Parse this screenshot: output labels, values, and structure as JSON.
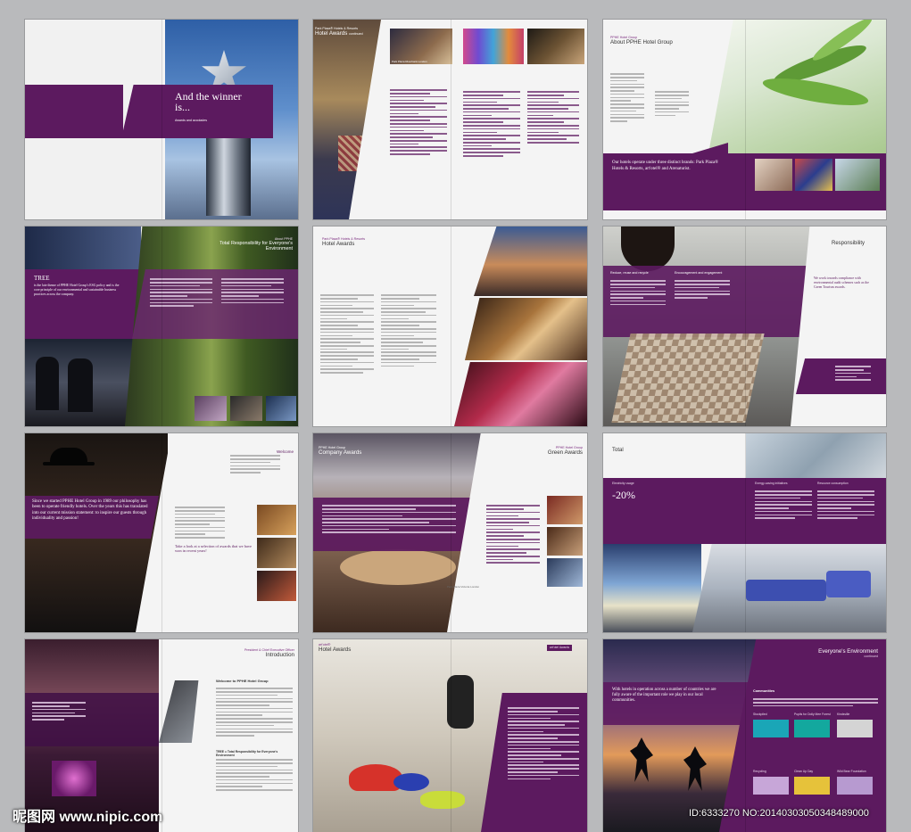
{
  "spreads": {
    "s1": {
      "title": "And the winner is...",
      "subtitle": "Awards and accolades"
    },
    "s2": {
      "brand": "Park Plaza® Hotels & Resorts",
      "title": "Hotel Awards",
      "title_suffix": "continued",
      "caption": "Park Plaza Riverbank London"
    },
    "s3": {
      "brand": "PPHE Hotel Group",
      "title": "About PPHE Hotel Group",
      "quote": "Our hotels operate under three distinct brands: Park Plaza® Hotels & Resorts, art'otel® and Arenaturist."
    },
    "s4": {
      "brand": "About PPHE",
      "title": "Total Responsibility for Everyone's Environment",
      "lead_title": "TREE",
      "lead_text": "is the late theme of PPHE Hotel Group's ESG policy and is the core principle of our environmental and sustainable business practices across the company."
    },
    "s5": {
      "brand": "Park Plaza® Hotels & Resorts",
      "title": "Hotel Awards"
    },
    "s6": {
      "title": "Responsibility",
      "col1": "Reduce, reuse and recycle",
      "col2": "Encouragement and engagement",
      "quote": "We work towards compliance with environmental audit schemes such as the Green Tourism awards."
    },
    "s7": {
      "tag": "Welcome",
      "quote": "Since we started PPHE Hotel Group in 1989 our philosophy has been to operate friendly hotels. Over the years this has translated into our current mission statement: to inspire our guests through individuality and passion!",
      "link": "Take a look at a selection of awards that we have won in recent years!"
    },
    "s8": {
      "left_brand": "PPHE Hotel Group",
      "left_title": "Company Awards",
      "right_brand": "PPHE Hotel Group",
      "right_title": "Green Awards",
      "caption": "Park Plaza Victoria London"
    },
    "s9": {
      "title": "Total",
      "label": "Electricity usage",
      "value": "-20%",
      "col1": "Energy-saving initiatives",
      "col2": "Resource consumption"
    },
    "s10": {
      "tag": "President & Chief Executive Officer",
      "title": "Introduction",
      "welcome": "Welcome to PPHE Hotel Group",
      "section": "TREE = Total Responsibility for Everyone's Environment"
    },
    "s11": {
      "brand": "art'otel®",
      "title": "Hotel Awards",
      "tag": "art'otel Awards"
    },
    "s12": {
      "title": "Everyone's Environment",
      "subtitle": "continued",
      "quote": "With hotels in operation across a number of countries we are fully aware of the important role we play in our local communities.",
      "right_head": "Communities",
      "box1": "Stockpiled",
      "box2": "Pupils for Dolly Mee Forest",
      "box3": "Kindsville",
      "box4": "Recycling",
      "box5": "Clean Up Day",
      "box6": "Wild Bear Foundation"
    }
  },
  "watermark": {
    "left": "昵图网 www.nipic.com",
    "right": "ID:6333270 NO:20140303050348489000"
  },
  "colors": {
    "purple": "#5c1a5f",
    "purple_light": "#6b2570",
    "deep": "#3f0f45",
    "background": "#b9babc"
  }
}
